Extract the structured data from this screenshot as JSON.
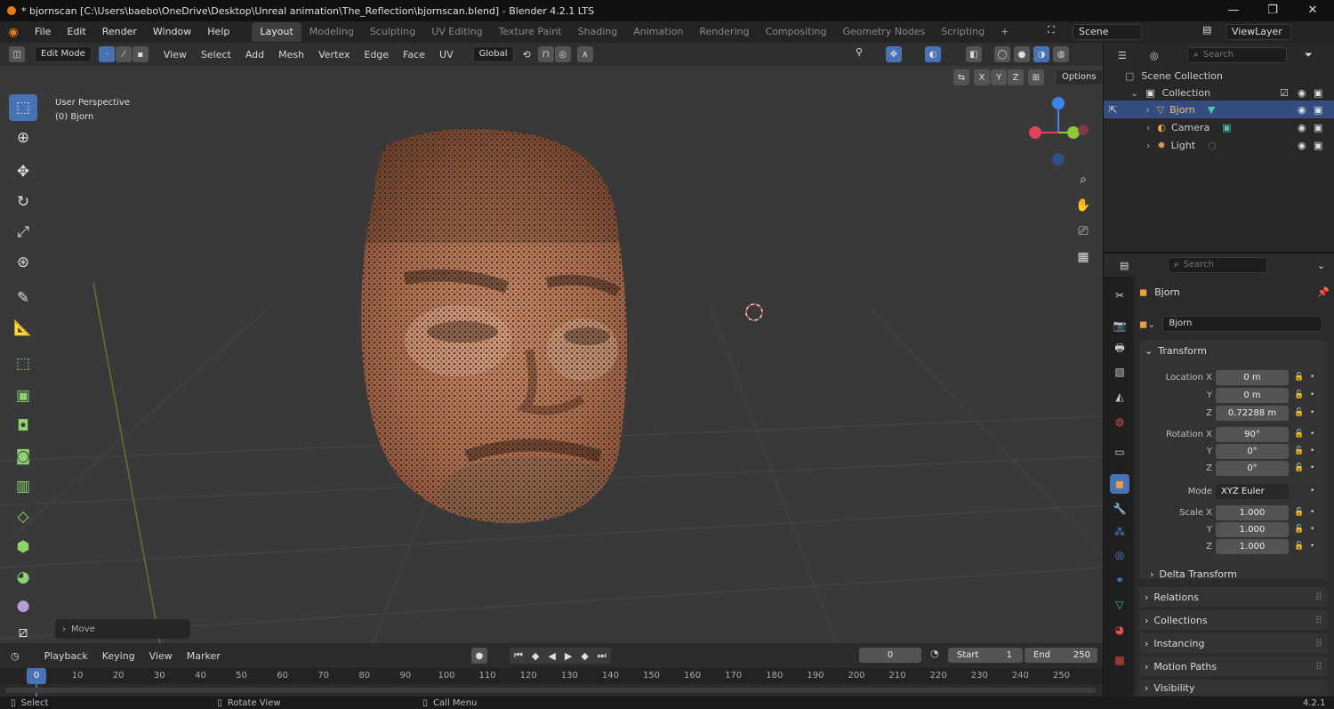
{
  "title": "* bjornscan [C:\\Users\\baebo\\OneDrive\\Desktop\\Unreal animation\\The_Reflection\\bjornscan.blend] - Blender 4.2.1 LTS",
  "window_controls": {
    "minimize": "—",
    "maximize": "❐",
    "close": "✕"
  },
  "menu": [
    "File",
    "Edit",
    "Render",
    "Window",
    "Help"
  ],
  "workspaces": [
    "Layout",
    "Modeling",
    "Sculpting",
    "UV Editing",
    "Texture Paint",
    "Shading",
    "Animation",
    "Rendering",
    "Compositing",
    "Geometry Nodes",
    "Scripting"
  ],
  "active_workspace": "Layout",
  "scene": "Scene",
  "view_layer": "ViewLayer",
  "viewport": {
    "mode": "Edit Mode",
    "menus": [
      "View",
      "Select",
      "Add",
      "Mesh",
      "Vertex",
      "Edge",
      "Face",
      "UV"
    ],
    "transform_orientation": "Global",
    "axes": [
      "X",
      "Y",
      "Z"
    ],
    "options": "Options",
    "overlay_line1": "User Perspective",
    "overlay_line2": "(0) Bjorn",
    "last_op": "Move"
  },
  "timeline": {
    "menus": [
      "Playback",
      "Keying",
      "View",
      "Marker"
    ],
    "current_frame": "0",
    "start_label": "Start",
    "start": "1",
    "end_label": "End",
    "end": "250",
    "ruler": [
      "0",
      "10",
      "20",
      "30",
      "40",
      "50",
      "60",
      "70",
      "80",
      "90",
      "100",
      "110",
      "120",
      "130",
      "140",
      "150",
      "160",
      "170",
      "180",
      "190",
      "200",
      "210",
      "220",
      "230",
      "240",
      "250"
    ]
  },
  "status": {
    "select": "Select",
    "rotate": "Rotate View",
    "menu": "Call Menu",
    "version": "4.2.1"
  },
  "outliner": {
    "search_placeholder": "Search",
    "scene_collection": "Scene Collection",
    "collection": "Collection",
    "items": [
      {
        "name": "Bjorn"
      },
      {
        "name": "Camera"
      },
      {
        "name": "Light"
      }
    ]
  },
  "properties": {
    "search_placeholder": "Search",
    "object_name": "Bjorn",
    "data_name": "Bjorn",
    "transform": "Transform",
    "location_label": "Location X",
    "location": [
      "0 m",
      "0 m",
      "0.72288 m"
    ],
    "rotation_label": "Rotation X",
    "rotation": [
      "90°",
      "0°",
      "0°"
    ],
    "mode_label": "Mode",
    "mode": "XYZ Euler",
    "scale_label": "Scale X",
    "scale": [
      "1.000",
      "1.000",
      "1.000"
    ],
    "y": "Y",
    "z": "Z",
    "delta": "Delta Transform",
    "sections": [
      "Relations",
      "Collections",
      "Instancing",
      "Motion Paths",
      "Visibility"
    ]
  },
  "colors": {
    "accent": "#4772b3",
    "x_axis": "#e2405b",
    "y_axis": "#8bc83d",
    "z_axis": "#3f82e8",
    "brand": "#e87d0d"
  }
}
